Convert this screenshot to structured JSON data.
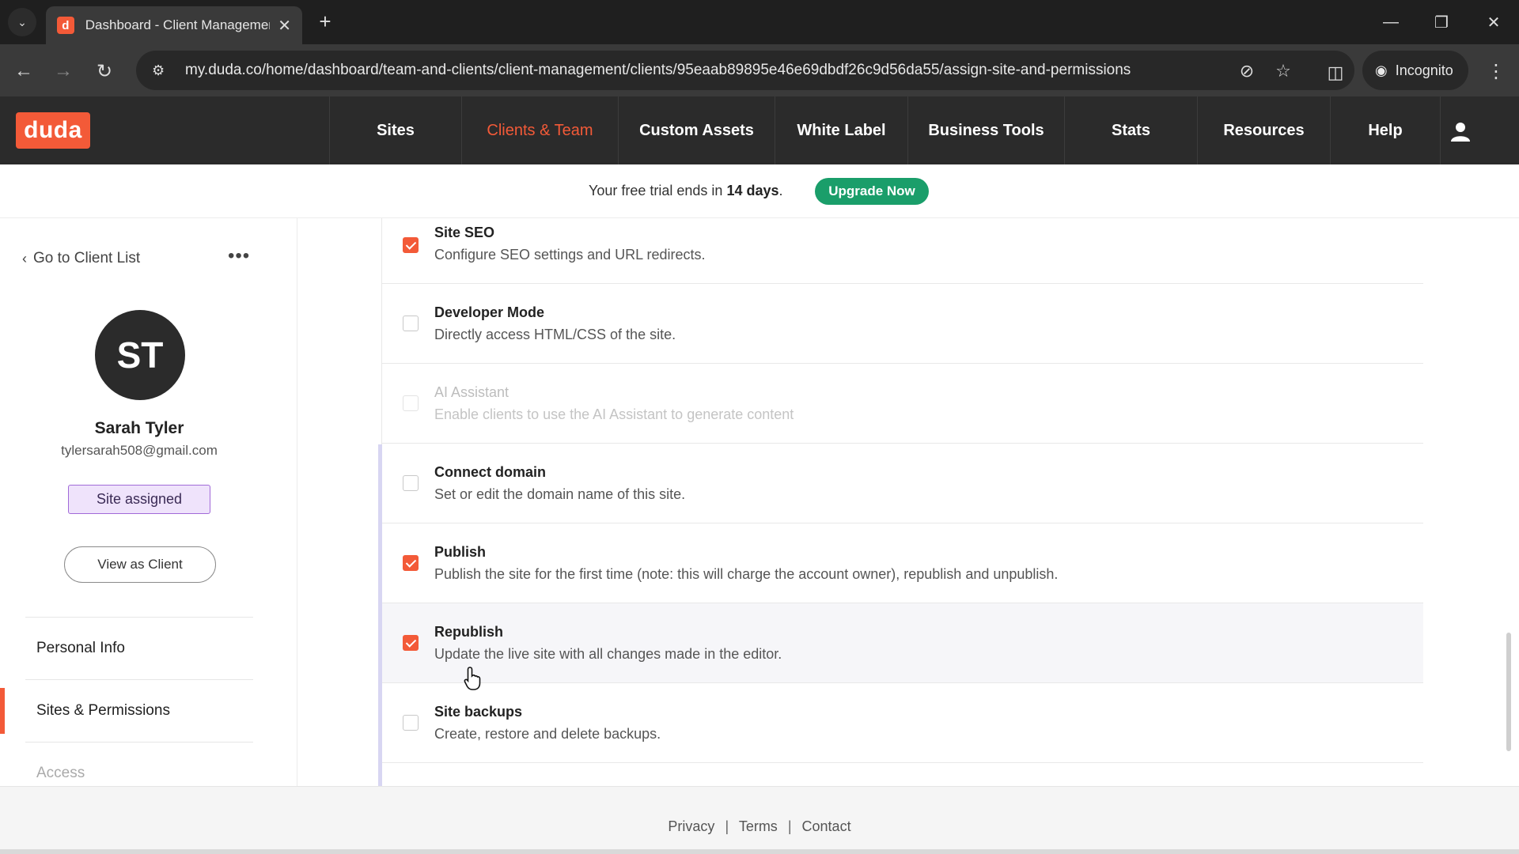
{
  "browser": {
    "tab_title": "Dashboard - Client Managemen",
    "tab_favicon": "d",
    "url": "my.duda.co/home/dashboard/team-and-clients/client-management/clients/95eaab89895e46e69dbdf26c9d56da55/assign-site-and-permissions",
    "incognito_label": "Incognito"
  },
  "app": {
    "logo": "duda",
    "nav": [
      {
        "label": "Sites",
        "active": false
      },
      {
        "label": "Clients & Team",
        "active": true
      },
      {
        "label": "Custom Assets",
        "active": false
      },
      {
        "label": "White Label",
        "active": false
      },
      {
        "label": "Business Tools",
        "active": false
      },
      {
        "label": "Stats",
        "active": false
      },
      {
        "label": "Resources",
        "active": false
      },
      {
        "label": "Help",
        "active": false
      }
    ],
    "accent_color": "#f35a38"
  },
  "trial_banner": {
    "text_prefix": "Your free trial ends in",
    "days": "14 days",
    "text_suffix": ".",
    "upgrade_label": "Upgrade Now"
  },
  "sidebar": {
    "back_label": "Go to Client List",
    "avatar_initials": "ST",
    "client_name": "Sarah Tyler",
    "client_email": "tylersarah508@gmail.com",
    "status_badge": "Site assigned",
    "view_as_client": "View as Client",
    "menu": [
      {
        "label": "Personal Info",
        "active": false
      },
      {
        "label": "Sites & Permissions",
        "active": true
      },
      {
        "label": "Access",
        "active": false
      }
    ]
  },
  "permissions": [
    {
      "title": "Site SEO",
      "description": "Configure SEO settings and URL redirects.",
      "checked": true,
      "disabled": false
    },
    {
      "title": "Developer Mode",
      "description": "Directly access HTML/CSS of the site.",
      "checked": false,
      "disabled": false
    },
    {
      "title": "AI Assistant",
      "description": "Enable clients to use the AI Assistant to generate content",
      "checked": false,
      "disabled": true
    },
    {
      "title": "Connect domain",
      "description": "Set or edit the domain name of this site.",
      "checked": false,
      "disabled": false
    },
    {
      "title": "Publish",
      "description": "Publish the site for the first time (note: this will charge the account owner), republish and unpublish.",
      "checked": true,
      "disabled": false
    },
    {
      "title": "Republish",
      "description": "Update the live site with all changes made in the editor.",
      "checked": true,
      "disabled": false
    },
    {
      "title": "Site backups",
      "description": "Create, restore and delete backups.",
      "checked": false,
      "disabled": false
    }
  ],
  "footer": {
    "privacy": "Privacy",
    "terms": "Terms",
    "contact": "Contact",
    "separator": "|"
  }
}
